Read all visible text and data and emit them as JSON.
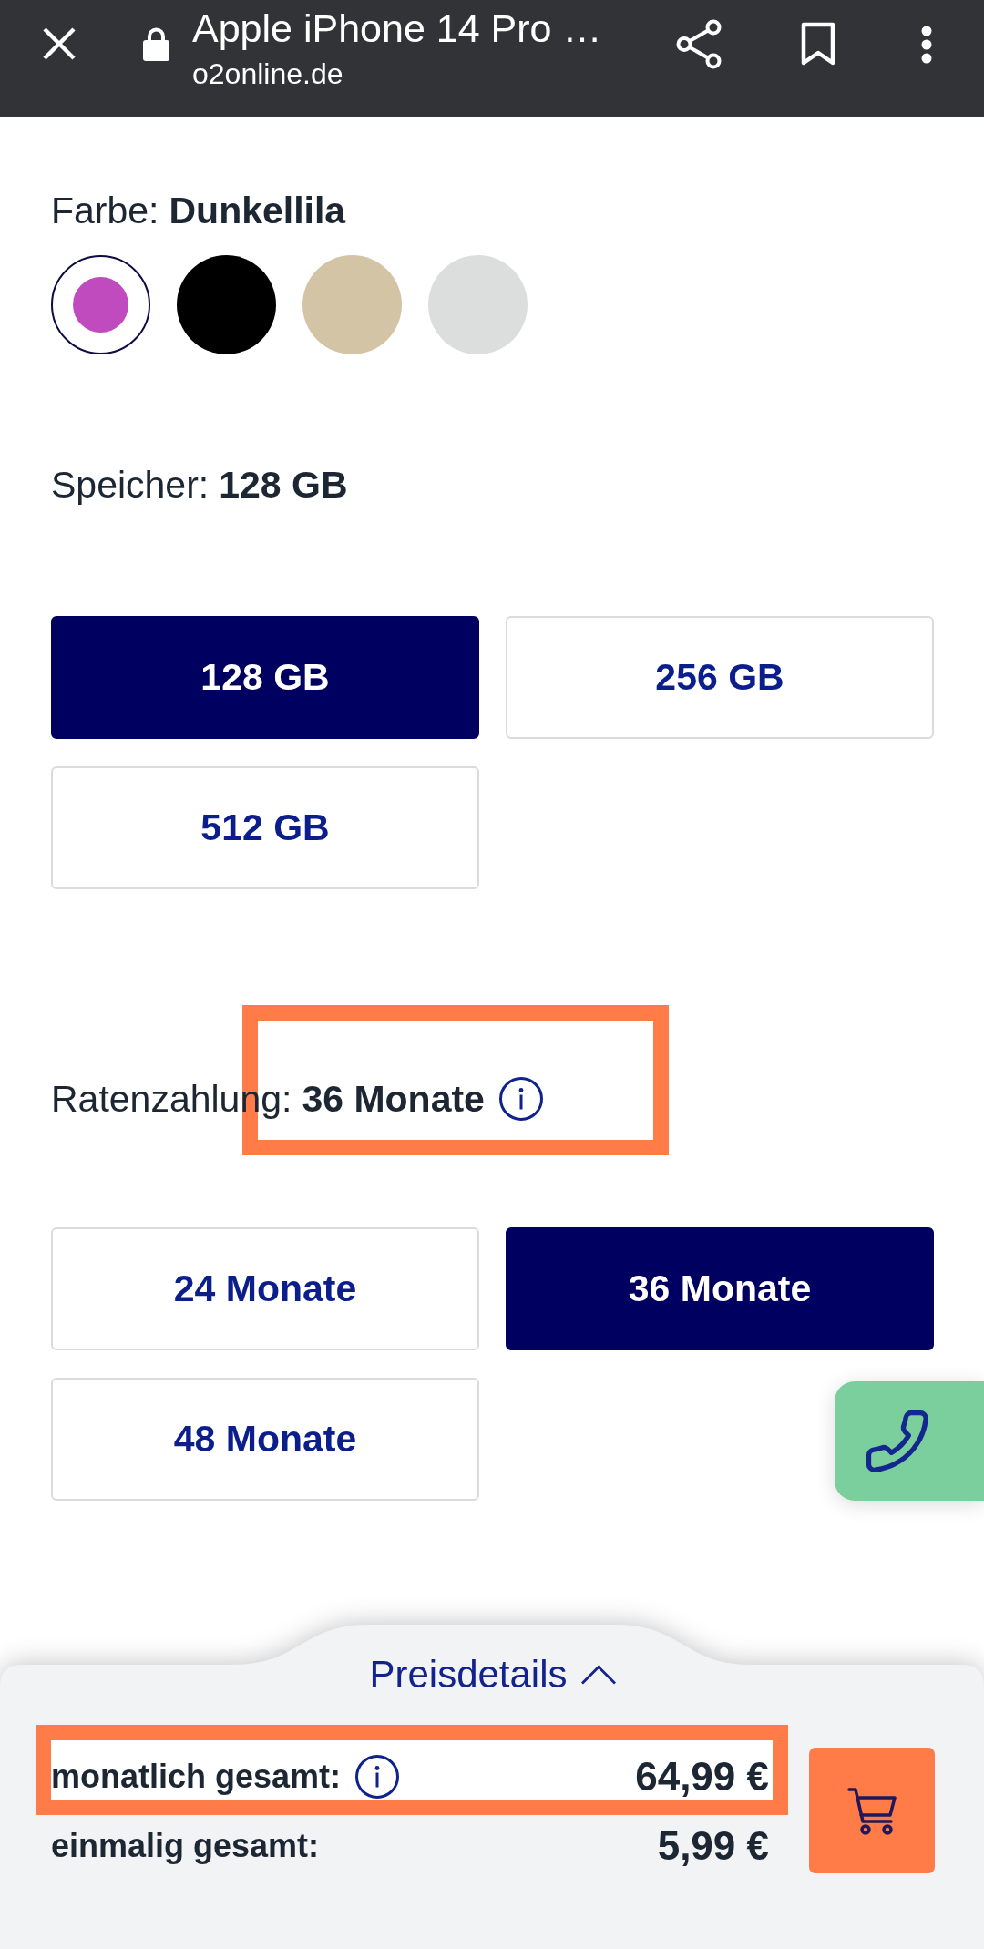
{
  "browser_bar": {
    "title": "Apple iPhone 14 Pro …",
    "url": "o2online.de"
  },
  "color_picker": {
    "label": "Farbe:",
    "value": "Dunkellila",
    "swatches": [
      {
        "color": "#bf4bbf",
        "selected": true
      },
      {
        "color": "#000000",
        "selected": false
      },
      {
        "color": "#d3c4a6",
        "selected": false
      },
      {
        "color": "#dcdddd",
        "selected": false
      }
    ]
  },
  "storage": {
    "label": "Speicher:",
    "value": "128 GB",
    "options": [
      {
        "label": "128 GB",
        "selected": true
      },
      {
        "label": "256 GB",
        "selected": false
      },
      {
        "label": "512 GB",
        "selected": false
      }
    ]
  },
  "installments": {
    "label": "Ratenzahlung:",
    "value": "36 Monate",
    "info_icon": true,
    "highlighted": true,
    "options": [
      {
        "label": "24 Monate",
        "selected": false
      },
      {
        "label": "36 Monate",
        "selected": true
      },
      {
        "label": "48 Monate",
        "selected": false
      }
    ]
  },
  "price_details": {
    "toggle": "Preisdetails",
    "rows": [
      {
        "label": "monatlich gesamt:",
        "info_icon": true,
        "highlighted": true,
        "amount": "64,99 €"
      },
      {
        "label": "einmalig gesamt:",
        "info_icon": false,
        "highlighted": false,
        "amount": "5,99 €"
      }
    ]
  }
}
